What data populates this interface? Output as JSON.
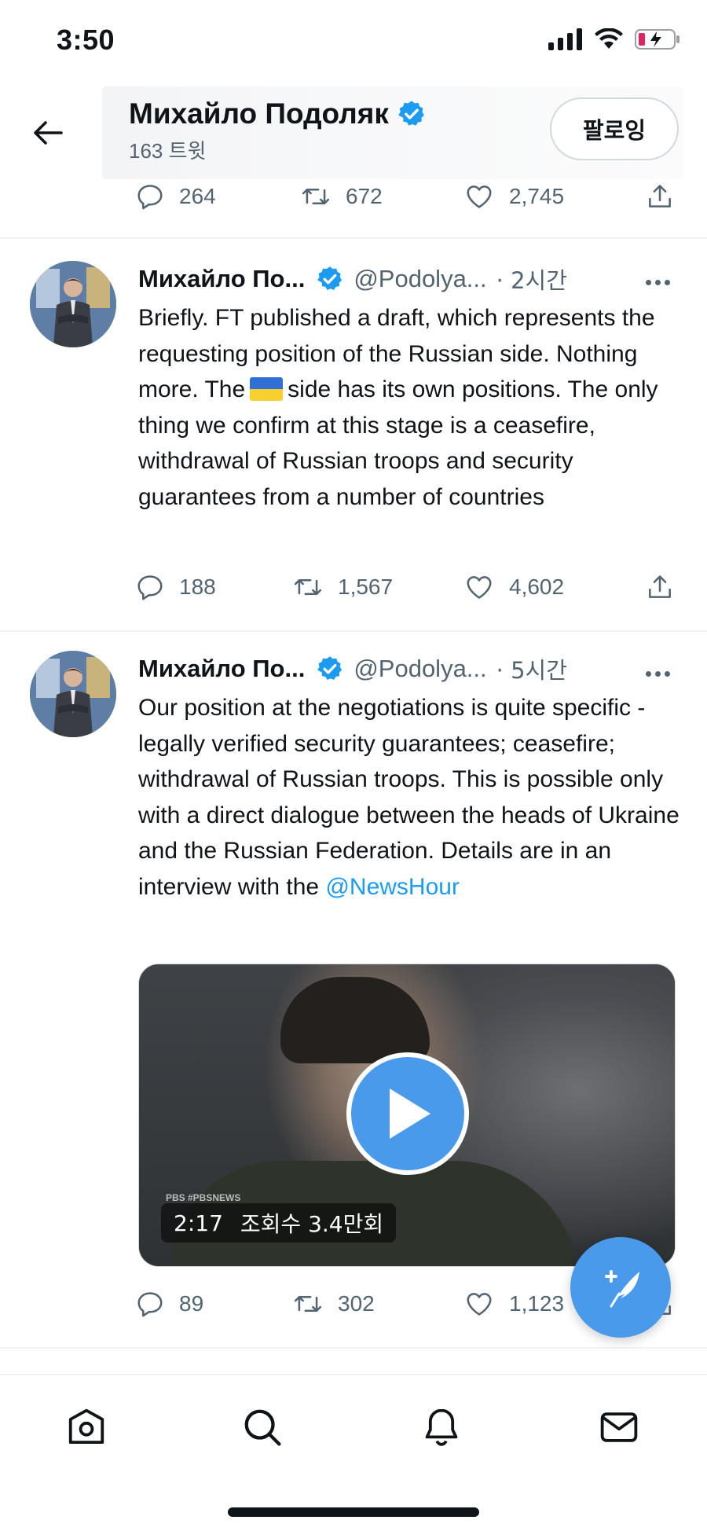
{
  "status_bar": {
    "time": "3:50"
  },
  "profile_header": {
    "name": "Михайло Подоляк",
    "tweet_count": "163 트윗",
    "follow_label": "팔로잉"
  },
  "top_tweet_actions": {
    "replies": "264",
    "retweets": "672",
    "likes": "2,745"
  },
  "tweets": [
    {
      "author_name": "Михайло По...",
      "handle": "@Podolya...",
      "time": "· 2시간",
      "text_before_flag": "Briefly. FT published a draft, which represents the requesting position of the Russian side. Nothing more.  The",
      "flag": "ukraine-flag",
      "text_after_flag": "side has its own positions. The only thing we confirm at this stage is a ceasefire, withdrawal of Russian troops and security guarantees from a number of countries",
      "replies": "188",
      "retweets": "1,567",
      "likes": "4,602"
    },
    {
      "author_name": "Михайло По...",
      "handle": "@Podolya...",
      "time": "· 5시간",
      "text": "Our position at the negotiations is quite specific - legally verified security guarantees; ceasefire; withdrawal of Russian troops. This is possible only with a direct dialogue between the heads of Ukraine and the Russian Federation. Details are in an interview with the",
      "mention": "@NewsHour",
      "video": {
        "duration": "2:17",
        "views": "조회수 3.4만회",
        "watermark": "PBS #PBSNEWS"
      },
      "replies": "89",
      "retweets": "302",
      "likes": "1,123"
    }
  ],
  "icons": {
    "back": "arrow-left-icon",
    "verified": "verified-badge-icon",
    "reply": "reply-icon",
    "retweet": "retweet-icon",
    "like": "heart-icon",
    "share": "share-icon",
    "more": "more-icon",
    "play": "play-icon",
    "compose": "compose-icon",
    "tabs": [
      "home-icon",
      "search-icon",
      "bell-icon",
      "mail-icon"
    ]
  },
  "colors": {
    "accent": "#1d9bf0",
    "fab": "#4a9aeb",
    "secondary_text": "#536471"
  }
}
